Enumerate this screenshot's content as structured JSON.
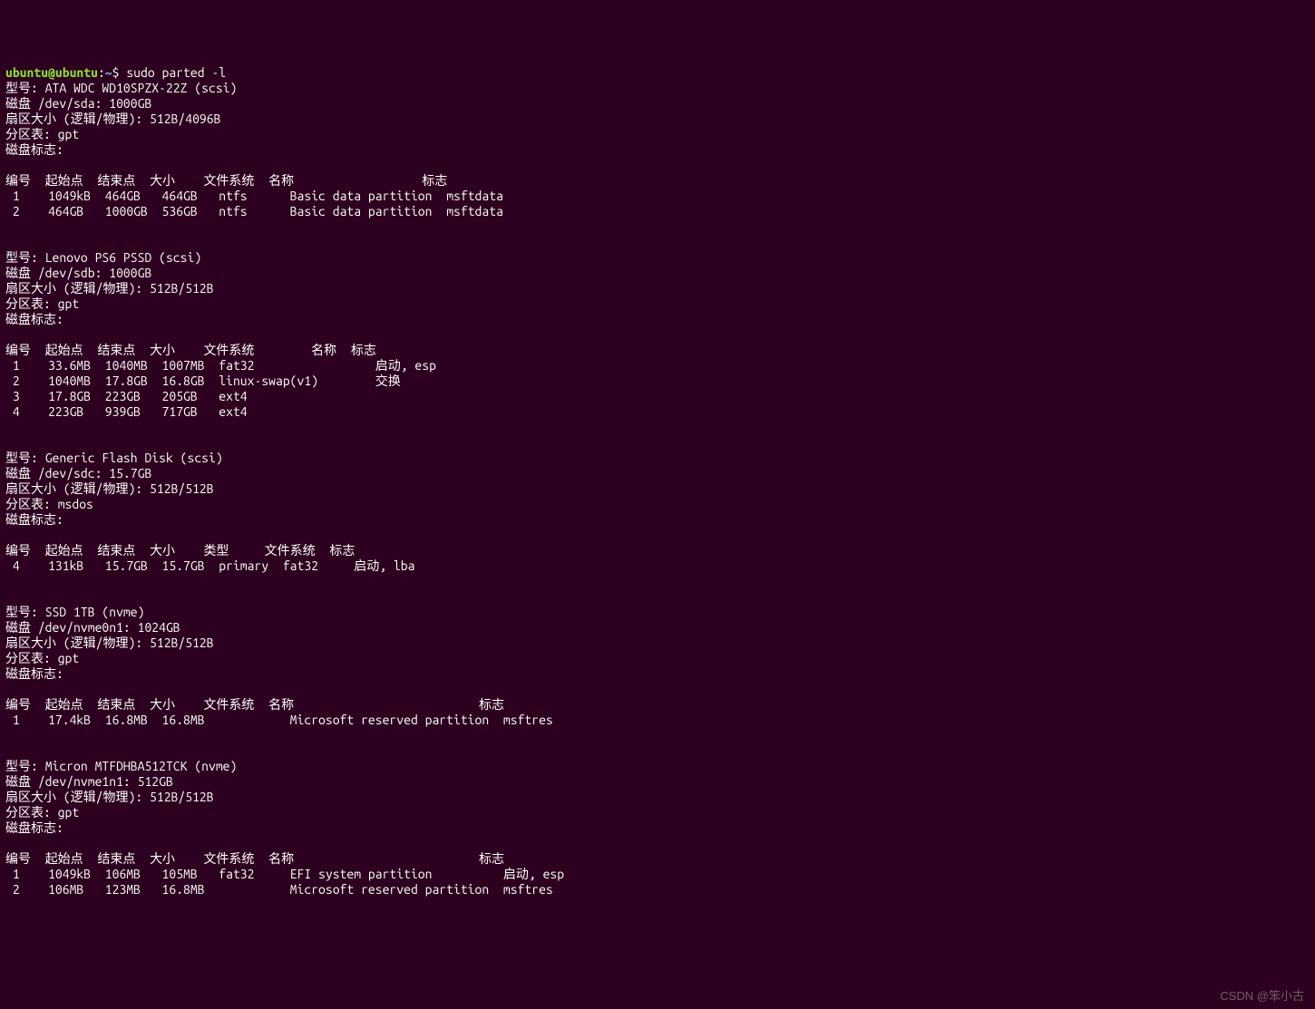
{
  "prompt": {
    "user": "ubuntu",
    "at": "@",
    "host": "ubuntu",
    "colon": ":",
    "path": "~",
    "dollar": "$",
    "command": "sudo parted -l"
  },
  "labels": {
    "model": "型号:",
    "disk": "磁盘",
    "sector": "扇区大小 (逻辑/物理):",
    "pttable": "分区表:",
    "diskflags": "磁盘标志:"
  },
  "hdr": {
    "num": "编号",
    "start": "起始点",
    "end": "结束点",
    "size": "大小",
    "fs": "文件系统",
    "type": "类型",
    "name": "名称",
    "flags": "标志"
  },
  "disk1": {
    "model": "ATA WDC WD10SPZX-22Z (scsi)",
    "path": "/dev/sda:",
    "cap": "1000GB",
    "sector": "512B/4096B",
    "pt": "gpt",
    "rows": [
      {
        "num": "1",
        "start": "1049kB",
        "end": "464GB",
        "size": "464GB",
        "fs": "ntfs",
        "name": "Basic data partition",
        "flags": "msftdata"
      },
      {
        "num": "2",
        "start": "464GB",
        "end": "1000GB",
        "size": "536GB",
        "fs": "ntfs",
        "name": "Basic data partition",
        "flags": "msftdata"
      }
    ]
  },
  "disk2": {
    "model": "Lenovo PS6 PSSD (scsi)",
    "path": "/dev/sdb:",
    "cap": "1000GB",
    "sector": "512B/512B",
    "pt": "gpt",
    "rows": [
      {
        "num": "1",
        "start": "33.6MB",
        "end": "1040MB",
        "size": "1007MB",
        "fs": "fat32",
        "name": "",
        "flags": "启动, esp"
      },
      {
        "num": "2",
        "start": "1040MB",
        "end": "17.8GB",
        "size": "16.8GB",
        "fs": "linux-swap(v1)",
        "name": "",
        "flags": "交换"
      },
      {
        "num": "3",
        "start": "17.8GB",
        "end": "223GB",
        "size": "205GB",
        "fs": "ext4",
        "name": "",
        "flags": ""
      },
      {
        "num": "4",
        "start": "223GB",
        "end": "939GB",
        "size": "717GB",
        "fs": "ext4",
        "name": "",
        "flags": ""
      }
    ]
  },
  "disk3": {
    "model": "Generic Flash Disk (scsi)",
    "path": "/dev/sdc:",
    "cap": "15.7GB",
    "sector": "512B/512B",
    "pt": "msdos",
    "rows": [
      {
        "num": "4",
        "start": "131kB",
        "end": "15.7GB",
        "size": "15.7GB",
        "type": "primary",
        "fs": "fat32",
        "flags": "启动, lba"
      }
    ]
  },
  "disk4": {
    "model": "SSD 1TB (nvme)",
    "path": "/dev/nvme0n1:",
    "cap": "1024GB",
    "sector": "512B/512B",
    "pt": "gpt",
    "rows": [
      {
        "num": "1",
        "start": "17.4kB",
        "end": "16.8MB",
        "size": "16.8MB",
        "fs": "",
        "name": "Microsoft reserved partition",
        "flags": "msftres"
      }
    ]
  },
  "disk5": {
    "model": "Micron MTFDHBA512TCK (nvme)",
    "path": "/dev/nvme1n1:",
    "cap": "512GB",
    "sector": "512B/512B",
    "pt": "gpt",
    "rows": [
      {
        "num": "1",
        "start": "1049kB",
        "end": "106MB",
        "size": "105MB",
        "fs": "fat32",
        "name": "EFI system partition",
        "flags": "启动, esp"
      },
      {
        "num": "2",
        "start": "106MB",
        "end": "123MB",
        "size": "16.8MB",
        "fs": "",
        "name": "Microsoft reserved partition",
        "flags": "msftres"
      }
    ]
  },
  "watermark": "CSDN @笨小古"
}
